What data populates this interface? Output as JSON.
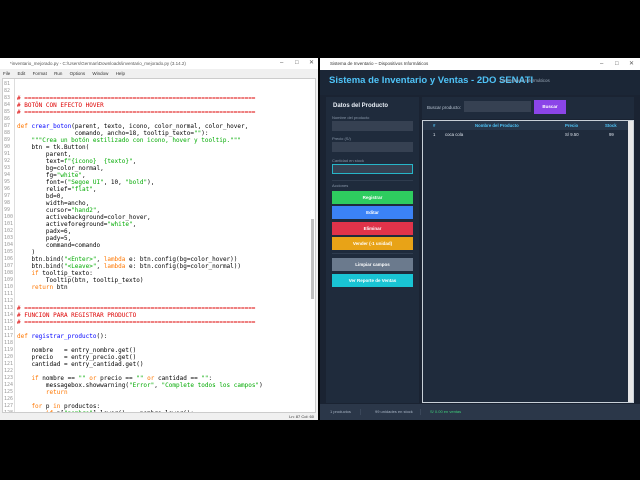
{
  "idle": {
    "title": "*inventario_mejorado.py - C:\\Users\\German\\Downloads\\inventario_mejorado.py (3.14.2)",
    "menu": [
      "File",
      "Edit",
      "Format",
      "Run",
      "Options",
      "Window",
      "Help"
    ],
    "window_controls": [
      "–",
      "□",
      "✕"
    ],
    "status": "Ln: 87   Col: 60",
    "first_line": 81,
    "code": [
      [],
      [],
      [
        [
          "c",
          "# ================================================================"
        ]
      ],
      [
        [
          "c",
          "# BOTÓN CON EFECTO HOVER"
        ]
      ],
      [
        [
          "c",
          "# ================================================================"
        ]
      ],
      [],
      [
        [
          "k",
          "def "
        ],
        [
          "d",
          "crear_boton"
        ],
        [
          "",
          "(parent, texto, icono, color_normal, color_hover,"
        ]
      ],
      [
        [
          "",
          "                comando, ancho=18, tooltip_texto="
        ],
        [
          "s",
          "\"\""
        ],
        [
          "",
          "):"
        ]
      ],
      [
        [
          "s",
          "    \"\"\"Crea un botón estilizado con icono, hover y tooltip.\"\"\""
        ]
      ],
      [
        [
          "",
          "    btn = tk.Button("
        ]
      ],
      [
        [
          "",
          "        parent,"
        ]
      ],
      [
        [
          "",
          "        text="
        ],
        [
          "s",
          "f\"{icono}  {texto}\""
        ],
        [
          "",
          ","
        ]
      ],
      [
        [
          "",
          "        bg=color_normal,"
        ]
      ],
      [
        [
          "",
          "        fg="
        ],
        [
          "s",
          "\"white\""
        ],
        [
          "",
          ","
        ]
      ],
      [
        [
          "",
          "        font=("
        ],
        [
          "s",
          "\"Segoe UI\""
        ],
        [
          "",
          ", 10, "
        ],
        [
          "s",
          "\"bold\""
        ],
        [
          "",
          "),"
        ]
      ],
      [
        [
          "",
          "        relief="
        ],
        [
          "s",
          "\"flat\""
        ],
        [
          "",
          ","
        ]
      ],
      [
        [
          "",
          "        bd=0,"
        ]
      ],
      [
        [
          "",
          "        width=ancho,"
        ]
      ],
      [
        [
          "",
          "        cursor="
        ],
        [
          "s",
          "\"hand2\""
        ],
        [
          "",
          ","
        ]
      ],
      [
        [
          "",
          "        activebackground=color_hover,"
        ]
      ],
      [
        [
          "",
          "        activeforeground="
        ],
        [
          "s",
          "\"white\""
        ],
        [
          "",
          ","
        ]
      ],
      [
        [
          "",
          "        padx=6,"
        ]
      ],
      [
        [
          "",
          "        pady=5,"
        ]
      ],
      [
        [
          "",
          "        command=comando"
        ]
      ],
      [
        [
          "",
          "    )"
        ]
      ],
      [
        [
          "",
          "    btn.bind("
        ],
        [
          "s",
          "\"<Enter>\""
        ],
        [
          "",
          ", "
        ],
        [
          "k",
          "lambda"
        ],
        [
          "",
          " e: btn.config(bg=color_hover))"
        ]
      ],
      [
        [
          "",
          "    btn.bind("
        ],
        [
          "s",
          "\"<Leave>\""
        ],
        [
          "",
          ", "
        ],
        [
          "k",
          "lambda"
        ],
        [
          "",
          " e: btn.config(bg=color_normal))"
        ]
      ],
      [
        [
          "k",
          "    if"
        ],
        [
          "",
          " tooltip_texto:"
        ]
      ],
      [
        [
          "",
          "        Tooltip(btn, tooltip_texto)"
        ]
      ],
      [
        [
          "k",
          "    return"
        ],
        [
          "",
          " btn"
        ]
      ],
      [],
      [],
      [
        [
          "c",
          "# ================================================================"
        ]
      ],
      [
        [
          "c",
          "# FUNCION PARA REGISTRAR PRODUCTO"
        ]
      ],
      [
        [
          "c",
          "# ================================================================"
        ]
      ],
      [],
      [
        [
          "k",
          "def "
        ],
        [
          "d",
          "registrar_producto"
        ],
        [
          "",
          "():"
        ]
      ],
      [],
      [
        [
          "",
          "    nombre   = entry_nombre.get()"
        ]
      ],
      [
        [
          "",
          "    precio   = entry_precio.get()"
        ]
      ],
      [
        [
          "",
          "    cantidad = entry_cantidad.get()"
        ]
      ],
      [],
      [
        [
          "k",
          "    if"
        ],
        [
          "",
          " nombre == "
        ],
        [
          "s",
          "\"\""
        ],
        [
          "k",
          " or"
        ],
        [
          "",
          " precio == "
        ],
        [
          "s",
          "\"\""
        ],
        [
          "k",
          " or"
        ],
        [
          "",
          " cantidad == "
        ],
        [
          "s",
          "\"\""
        ],
        [
          "",
          ":"
        ]
      ],
      [
        [
          "",
          "        messagebox.showwarning("
        ],
        [
          "s",
          "\"Error\""
        ],
        [
          "",
          ", "
        ],
        [
          "s",
          "\"Complete todos los campos\""
        ],
        [
          "",
          ")"
        ]
      ],
      [
        [
          "k",
          "        return"
        ]
      ],
      [],
      [
        [
          "k",
          "    for"
        ],
        [
          "",
          " p "
        ],
        [
          "k",
          "in"
        ],
        [
          "",
          " productos:"
        ]
      ],
      [
        [
          "k",
          "        if"
        ],
        [
          "",
          " p["
        ],
        [
          "s",
          "\"nombre\""
        ],
        [
          "",
          "].lower() == nombre.lower():"
        ]
      ]
    ]
  },
  "app": {
    "window_title": "Sistema de Inventario – Dispositivos Informáticos",
    "window_controls": [
      "–",
      "□",
      "✕"
    ],
    "header_title": "Sistema de Inventario y Ventas - 2DO SENATI",
    "header_subtitle": "Dispositivos Informáticos",
    "form": {
      "title": "Datos del Producto",
      "name_label": "Nombre del producto",
      "price_label": "Precio (S/)",
      "stock_label": "Cantidad en stock",
      "name_value": "",
      "price_value": "",
      "stock_value": ""
    },
    "actions_label": "Acciones",
    "buttons": {
      "register": "Registrar",
      "edit": "Editar",
      "delete": "Eliminar",
      "sell": "Vender (-1 unidad)",
      "clear": "Limpiar campos",
      "report": "Ver Reporte de Ventas"
    },
    "colors": {
      "register": "#2ecc5f",
      "edit": "#3b82f6",
      "delete": "#e0334a",
      "sell": "#e8a317",
      "clear": "#6b7a8d",
      "report": "#19c4d4",
      "accent": "#4fc3f7",
      "search": "#8b45e8"
    },
    "search": {
      "label": "Buscar producto:",
      "value": "",
      "button": "Buscar"
    },
    "table": {
      "headers": [
        "#",
        "Nombre del Producto",
        "Precio",
        "Stock"
      ],
      "rows": [
        [
          "1",
          "coca cola",
          "S/ 9.50",
          "99"
        ]
      ]
    },
    "status": {
      "products": "1 productos",
      "units": "99 unidades en stock",
      "sales": "S/ 0.00 en ventas"
    }
  }
}
